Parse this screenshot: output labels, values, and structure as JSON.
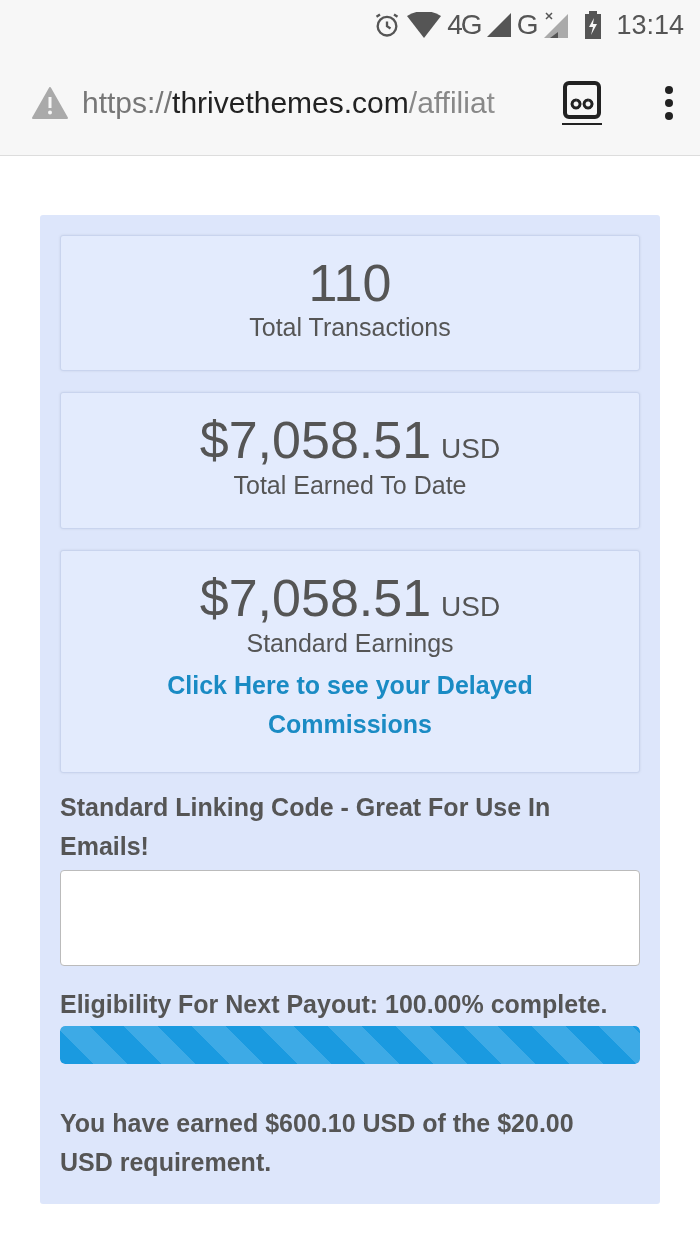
{
  "status_bar": {
    "time": "13:14",
    "network_1": "4G",
    "network_2": "G"
  },
  "address_bar": {
    "scheme": "https://",
    "host": "thrivethemes.com",
    "path": "/affiliat"
  },
  "stats": [
    {
      "value": "110",
      "label": "Total Transactions"
    },
    {
      "value": "$7,058.51",
      "unit": "USD",
      "label": "Total Earned To Date"
    },
    {
      "value": "$7,058.51",
      "unit": "USD",
      "label": "Standard Earnings",
      "link": "Click Here to see your Delayed Commissions"
    }
  ],
  "linking_code": {
    "label": "Standard Linking Code - Great For Use In Emails!"
  },
  "payout": {
    "label": "Eligibility For Next Payout: 100.00% complete.",
    "level": 1,
    "note": "You have earned $600.10 USD of the $20.00 USD requirement."
  }
}
